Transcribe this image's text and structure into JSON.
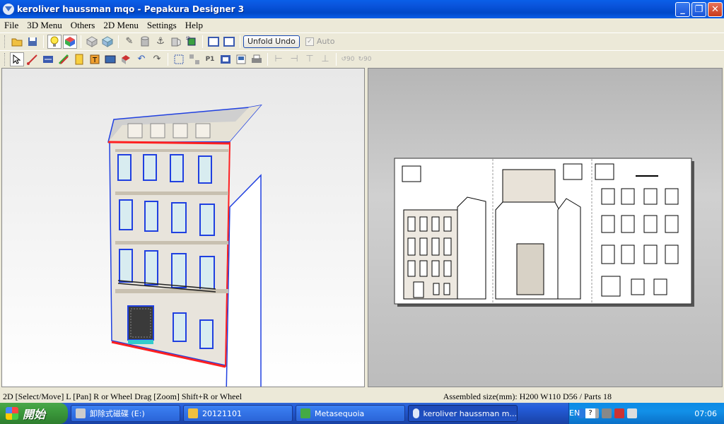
{
  "window": {
    "title": "keroliver haussman mqo - Pepakura Designer 3",
    "controls": {
      "minimize": "_",
      "maximize": "❐",
      "close": "✕"
    }
  },
  "menubar": {
    "items": [
      {
        "label": "File"
      },
      {
        "label": "3D Menu"
      },
      {
        "label": "Others"
      },
      {
        "label": "2D Menu"
      },
      {
        "label": "Settings"
      },
      {
        "label": "Help"
      }
    ]
  },
  "toolbar1": {
    "unfold_undo_label": "Unfold Undo",
    "auto_label": "Auto",
    "auto_checked": true
  },
  "toolbar2": {
    "rot_left_label": "90",
    "rot_right_label": "90"
  },
  "statusbar": {
    "left": "2D [Select/Move] L [Pan] R or Wheel Drag [Zoom] Shift+R or Wheel",
    "right": "Assembled size(mm): H200  W110  D56 / Parts 18"
  },
  "taskbar": {
    "start_label": "開始",
    "tasks": [
      {
        "label": "卸除式磁碟 (E:)"
      },
      {
        "label": "20121101"
      },
      {
        "label": "Metasequoia"
      },
      {
        "label": "keroliver haussman m..."
      }
    ],
    "language": "EN",
    "help": "?",
    "clock": "07:06"
  },
  "colors": {
    "titlebar": "#0a54dc",
    "taskbar": "#245edc",
    "start": "#3c9a3c",
    "model_edge_cut": "#ff2020",
    "model_edge_fold": "#2040e0"
  }
}
